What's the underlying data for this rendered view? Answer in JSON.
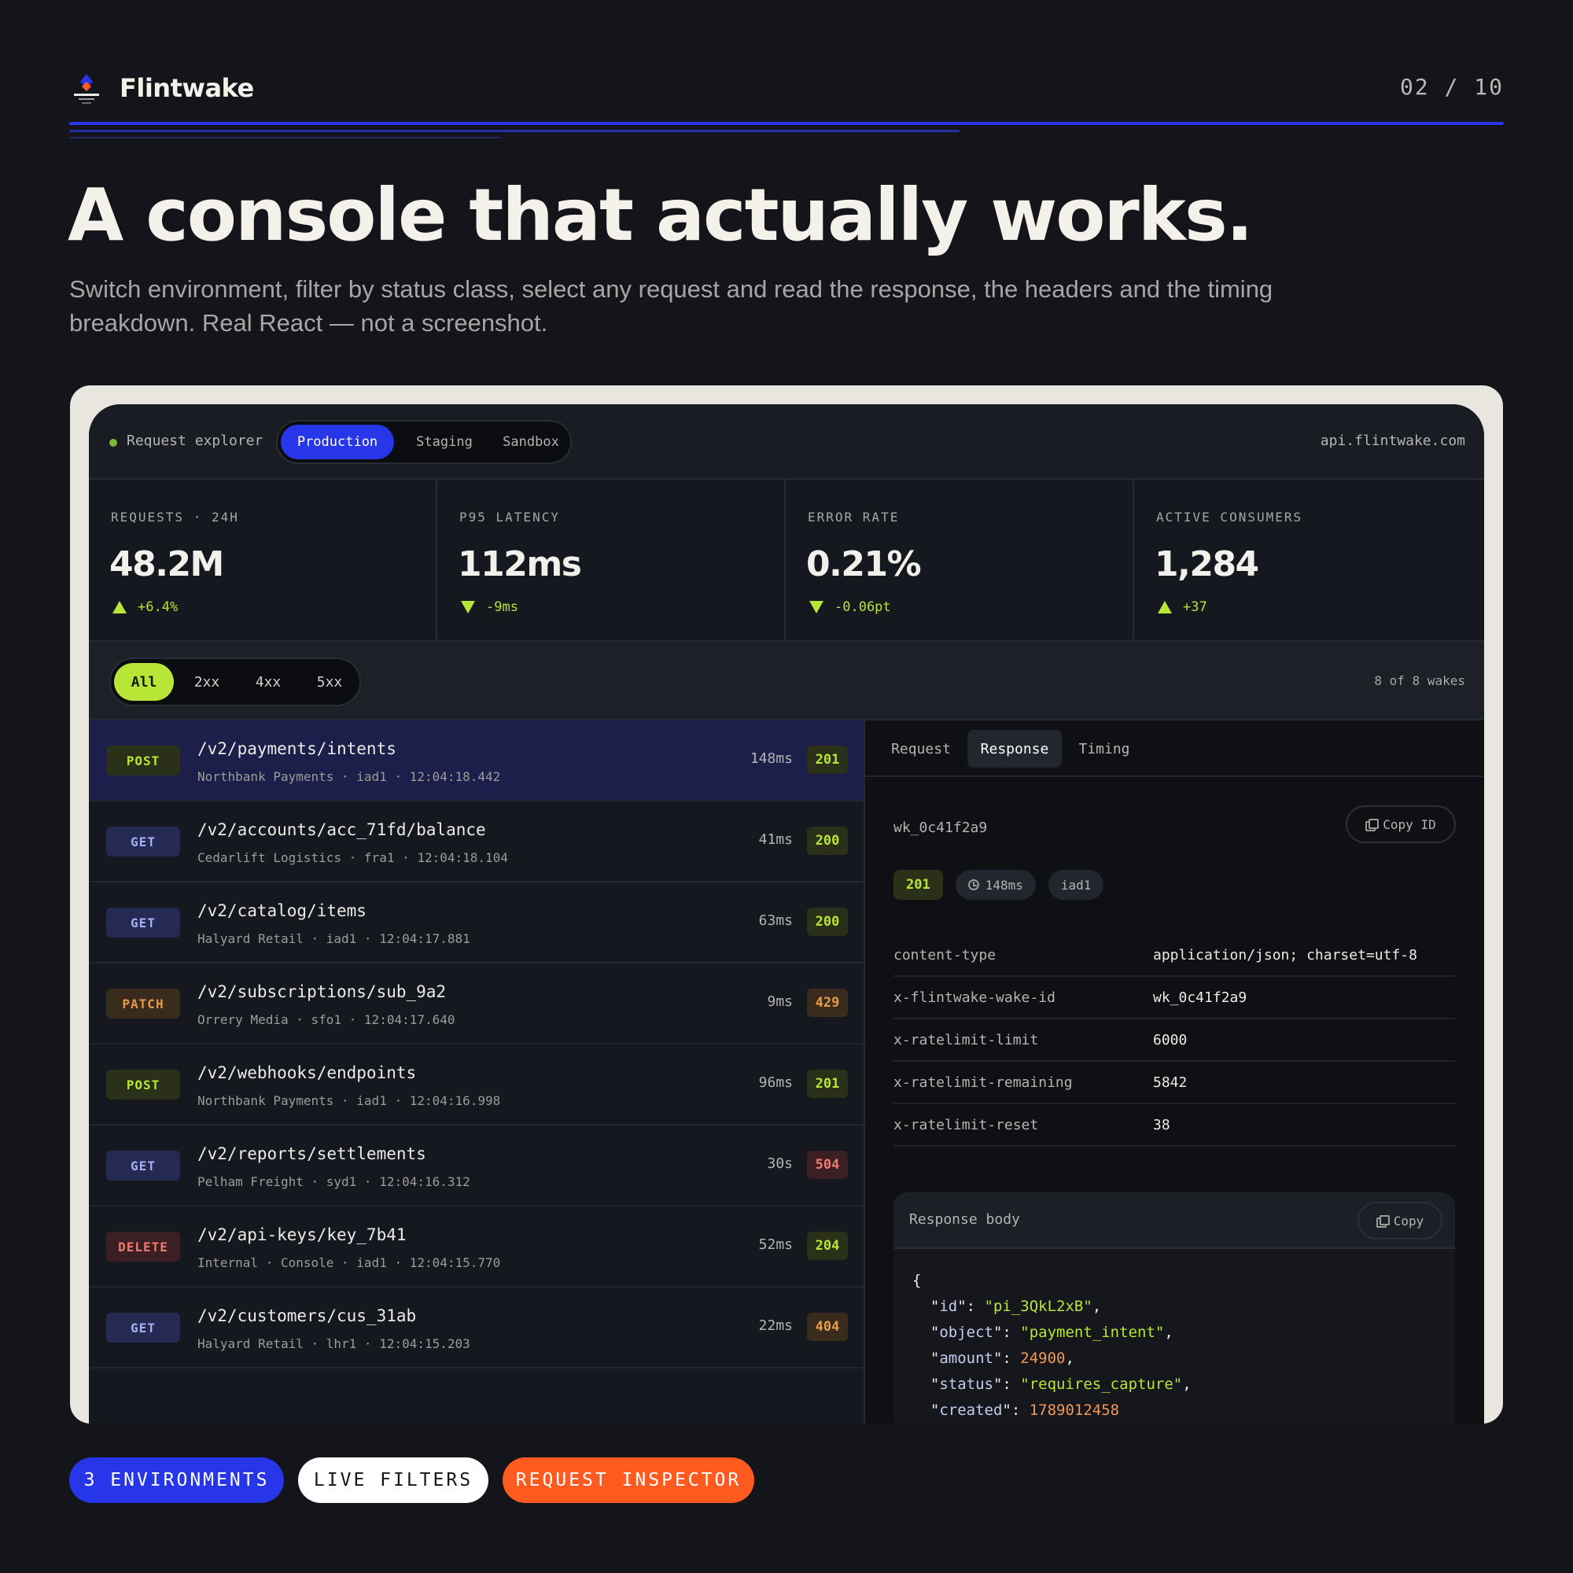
{
  "brand": {
    "name": "Flintwake"
  },
  "page_counter": "02 / 10",
  "headline": "A console that actually works.",
  "subhead": "Switch environment, filter by status class, select any request and read the response, the headers and the timing breakdown. Real React — not a screenshot.",
  "colors": {
    "accent_blue": "#2636e8",
    "accent_lime": "#b8e636",
    "accent_orange": "#ff5a1f",
    "background": "#13151b"
  },
  "app": {
    "explorer_label": "Request explorer",
    "environments": [
      "Production",
      "Staging",
      "Sandbox"
    ],
    "active_environment": "Production",
    "api_host": "api.flintwake.com",
    "stats": [
      {
        "label": "REQUESTS · 24H",
        "value": "48.2M",
        "delta": "+6.4%",
        "direction": "up"
      },
      {
        "label": "P95 LATENCY",
        "value": "112ms",
        "delta": "-9ms",
        "direction": "down"
      },
      {
        "label": "ERROR RATE",
        "value": "0.21%",
        "delta": "-0.06pt",
        "direction": "down"
      },
      {
        "label": "ACTIVE CONSUMERS",
        "value": "1,284",
        "delta": "+37",
        "direction": "up"
      }
    ],
    "filters": [
      "All",
      "2xx",
      "4xx",
      "5xx"
    ],
    "active_filter": "All",
    "wake_count": "8 of 8 wakes",
    "requests": [
      {
        "method": "POST",
        "path": "/v2/payments/intents",
        "meta": "Northbank Payments · iad1 · 12:04:18.442",
        "duration": "148ms",
        "status": "201"
      },
      {
        "method": "GET",
        "path": "/v2/accounts/acc_71fd/balance",
        "meta": "Cedarlift Logistics · fra1 · 12:04:18.104",
        "duration": "41ms",
        "status": "200"
      },
      {
        "method": "GET",
        "path": "/v2/catalog/items",
        "meta": "Halyard Retail · iad1 · 12:04:17.881",
        "duration": "63ms",
        "status": "200"
      },
      {
        "method": "PATCH",
        "path": "/v2/subscriptions/sub_9a2",
        "meta": "Orrery Media · sfo1 · 12:04:17.640",
        "duration": "9ms",
        "status": "429"
      },
      {
        "method": "POST",
        "path": "/v2/webhooks/endpoints",
        "meta": "Northbank Payments · iad1 · 12:04:16.998",
        "duration": "96ms",
        "status": "201"
      },
      {
        "method": "GET",
        "path": "/v2/reports/settlements",
        "meta": "Pelham Freight · syd1 · 12:04:16.312",
        "duration": "30s",
        "status": "504"
      },
      {
        "method": "DELETE",
        "path": "/v2/api-keys/key_7b41",
        "meta": "Internal · Console · iad1 · 12:04:15.770",
        "duration": "52ms",
        "status": "204"
      },
      {
        "method": "GET",
        "path": "/v2/customers/cus_31ab",
        "meta": "Halyard Retail · lhr1 · 12:04:15.203",
        "duration": "22ms",
        "status": "404"
      }
    ],
    "inspector": {
      "tabs": [
        "Request",
        "Response",
        "Timing"
      ],
      "active_tab": "Response",
      "wake_id": "wk_0c41f2a9",
      "copy_id_label": "Copy ID",
      "status": "201",
      "duration": "148ms",
      "region": "iad1",
      "headers": [
        {
          "key": "content-type",
          "value": "application/json; charset=utf-8"
        },
        {
          "key": "x-flintwake-wake-id",
          "value": "wk_0c41f2a9"
        },
        {
          "key": "x-ratelimit-limit",
          "value": "6000"
        },
        {
          "key": "x-ratelimit-remaining",
          "value": "5842"
        },
        {
          "key": "x-ratelimit-reset",
          "value": "38"
        }
      ],
      "body_title": "Response body",
      "copy_label": "Copy",
      "body": [
        {
          "key": "id",
          "value": "\"pi_3QkL2xB\"",
          "kind": "str"
        },
        {
          "key": "object",
          "value": "\"payment_intent\"",
          "kind": "str"
        },
        {
          "key": "amount",
          "value": "24900",
          "kind": "num"
        },
        {
          "key": "status",
          "value": "\"requires_capture\"",
          "kind": "str"
        },
        {
          "key": "created",
          "value": "1789012458",
          "kind": "num"
        }
      ]
    }
  },
  "pills": [
    "3 ENVIRONMENTS",
    "LIVE FILTERS",
    "REQUEST INSPECTOR"
  ]
}
